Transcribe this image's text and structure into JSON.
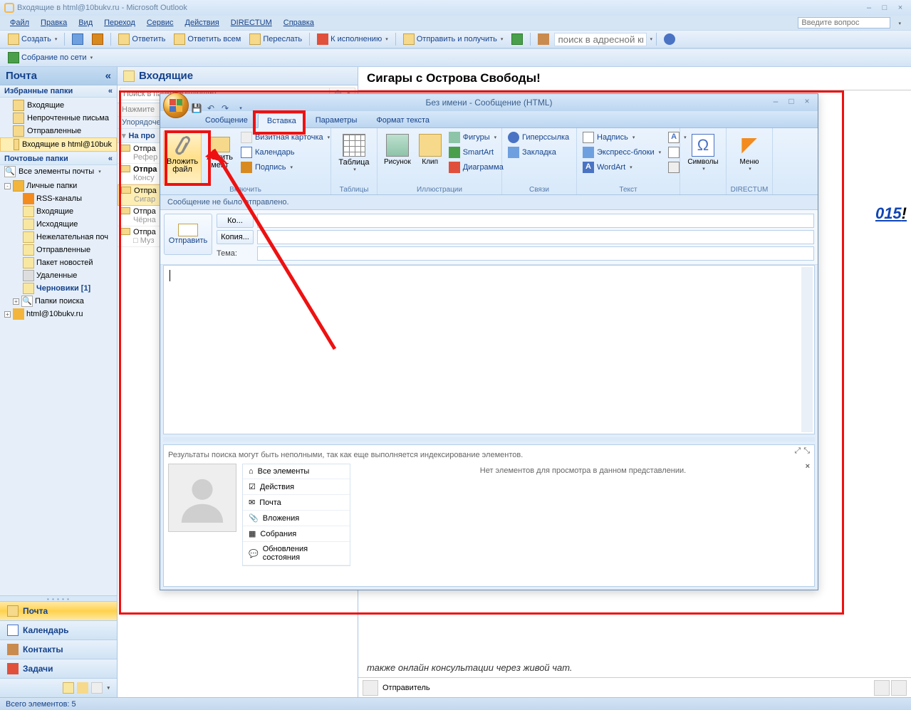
{
  "titlebar": {
    "text": "Входящие в html@10bukv.ru - Microsoft Outlook"
  },
  "menubar": [
    "Файл",
    "Правка",
    "Вид",
    "Переход",
    "Сервис",
    "Действия",
    "DIRECTUM",
    "Справка"
  ],
  "question_placeholder": "Введите вопрос",
  "toolbar1": {
    "create": "Создать",
    "print": "",
    "reply": "Ответить",
    "reply_all": "Ответить всем",
    "forward": "Переслать",
    "followup": "К исполнению",
    "sendreceive": "Отправить и получить",
    "addressbook": "поиск в адресной книге"
  },
  "toolbar2": {
    "meeting": "Собрание по сети"
  },
  "nav": {
    "header": "Почта",
    "chev": "«",
    "fav_label": "Избранные папки",
    "fav_chev": "«",
    "fav": [
      "Входящие",
      "Непрочтенные письма",
      "Отправленные",
      "Входящие в html@10buk"
    ],
    "mail_label": "Почтовые папки",
    "mail_chev": "«",
    "all_items": "Все элементы почты",
    "tree": {
      "root": "Личные папки",
      "items": [
        {
          "t": "RSS-каналы"
        },
        {
          "t": "Входящие"
        },
        {
          "t": "Исходящие"
        },
        {
          "t": "Нежелательная поч"
        },
        {
          "t": "Отправленные"
        },
        {
          "t": "Пакет новостей"
        },
        {
          "t": "Удаленные"
        },
        {
          "t": "Черновики [1]",
          "bold": true
        },
        {
          "t": "Папки поиска"
        }
      ],
      "account": "html@10bukv.ru"
    },
    "sections": [
      "Почта",
      "Календарь",
      "Контакты",
      "Задачи"
    ]
  },
  "list": {
    "header": "Входящие",
    "search_placeholder": "Поиск в папке \"Входящие\"",
    "click_add": "Нажмите",
    "arrange": "Упорядоче",
    "group": "На про",
    "msgs": [
      {
        "from": "Отпра",
        "sub": "Рефер"
      },
      {
        "from": "Отпра",
        "sub": "Консу",
        "bold": true
      },
      {
        "from": "Отпра",
        "sub": "Сигар",
        "sel": true
      },
      {
        "from": "Отпра",
        "sub": "Чёрна"
      },
      {
        "from": "Отпра",
        "sub": "□ Муз"
      }
    ]
  },
  "reading": {
    "title": "Сигары с Острова Свободы!",
    "fragment": "015",
    "excl": "!",
    "body_line": "также онлайн консультации через живой чат.",
    "sender": "Отправитель"
  },
  "status": "Всего элементов: 5",
  "compose": {
    "title": "Без имени - Сообщение (HTML)",
    "tabs": [
      "Сообщение",
      "Вставка",
      "Параметры",
      "Формат текста"
    ],
    "ribbon": {
      "attach_file": "Вложить файл",
      "attach_item": "ложить мент",
      "include": "Включить",
      "bizcard": "Визитная карточка",
      "calendar": "Календарь",
      "signature": "Подпись",
      "table": "Таблица",
      "tables": "Таблицы",
      "picture": "Рисунок",
      "clip": "Клип",
      "illustr": "Иллюстрации",
      "shapes": "Фигуры",
      "smartart": "SmartArt",
      "chart": "Диаграмма",
      "hyperlink": "Гиперссылка",
      "bookmark": "Закладка",
      "links": "Связи",
      "textbox": "Надпись",
      "quickparts": "Экспресс-блоки",
      "wordart": "WordArt",
      "text": "Текст",
      "symbols": "Символы",
      "directum": "DIRECTUM",
      "menu": "Меню"
    },
    "notsent": "Сообщение не было отправлено.",
    "send": "Отправить",
    "to": "Ко...",
    "cc": "Копия...",
    "subj": "Тема:",
    "people": {
      "hint": "Результаты поиска могут быть неполными, так как еще выполняется индексирование элементов.",
      "noitems": "Нет элементов для просмотра в данном представлении.",
      "menu": [
        "Все элементы",
        "Действия",
        "Почта",
        "Вложения",
        "Собрания",
        "Обновления состояния"
      ]
    }
  }
}
